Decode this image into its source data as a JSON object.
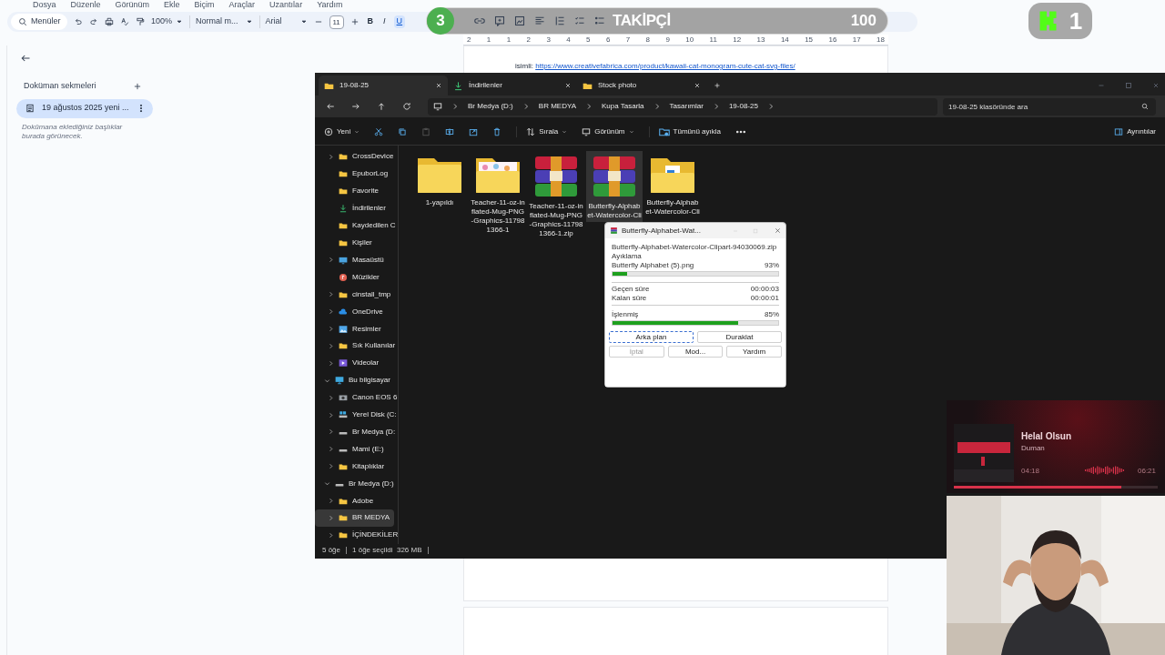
{
  "docs": {
    "menu": [
      "Dosya",
      "Düzenle",
      "Görünüm",
      "Ekle",
      "Biçim",
      "Araçlar",
      "Uzantılar",
      "Yardım"
    ],
    "toolbar": {
      "search": "Menüler",
      "zoom": "100%",
      "style": "Normal m...",
      "font": "Arial",
      "font_size": "11",
      "bold": "B",
      "italic": "I",
      "underline": "U"
    },
    "outline": {
      "title": "Doküman sekmeleri",
      "tabs": [
        {
          "label": "19 ağustos 2025 yeni ...",
          "selected": true
        }
      ],
      "hint": "Dokümana eklediğiniz başlıklar burada görünecek."
    },
    "ruler": [
      "2",
      "1",
      "1",
      "2",
      "3",
      "4",
      "5",
      "6",
      "7",
      "8",
      "9",
      "10",
      "11",
      "12",
      "13",
      "14",
      "15",
      "16",
      "17",
      "18"
    ],
    "text": "isimli:",
    "link": "https://www.creativefabrica.com/product/kawaii-cat-monogram-cute-cat-svg-files/"
  },
  "follower_bar": {
    "step": "3",
    "label": "TAKİPÇİ",
    "count": "100"
  },
  "badge": {
    "count": "1"
  },
  "explorer": {
    "tabs": [
      {
        "label": "19-08-25",
        "kind": "folder",
        "selected": true
      },
      {
        "label": "İndirilenler",
        "kind": "download",
        "selected": false
      },
      {
        "label": "Stock photo",
        "kind": "folder",
        "selected": false
      }
    ],
    "breadcrumbs": [
      "Br Medya (D:)",
      "BR MEDYA",
      "Kupa Tasarla",
      "Tasarımlar",
      "19-08-25"
    ],
    "search": {
      "placeholder": "19-08-25 klasöründe ara"
    },
    "commands": {
      "new": "Yeni",
      "sort": "Sırala",
      "view": "Görünüm",
      "extract": "Tümünü ayıkla",
      "details": "Ayrıntılar"
    },
    "sidebar": [
      {
        "label": "CrossDevice",
        "kind": "folder",
        "collapsed": true,
        "selected": false
      },
      {
        "label": "EpuborLog",
        "kind": "folder",
        "collapsed": false,
        "selected": false
      },
      {
        "label": "Favorite",
        "kind": "folder",
        "collapsed": false,
        "selected": false
      },
      {
        "label": "İndirilenler",
        "kind": "download",
        "collapsed": false,
        "selected": false
      },
      {
        "label": "Kaydedilen C",
        "kind": "folder",
        "collapsed": false,
        "selected": false
      },
      {
        "label": "Kişiler",
        "kind": "folder",
        "collapsed": false,
        "selected": false
      },
      {
        "label": "Masaüstü",
        "kind": "desktop",
        "collapsed": true,
        "selected": false
      },
      {
        "label": "Müzikler",
        "kind": "music",
        "collapsed": false,
        "selected": false
      },
      {
        "label": "cinstall_tmp",
        "kind": "folder",
        "collapsed": true,
        "selected": false
      },
      {
        "label": "OneDrive",
        "kind": "cloud",
        "collapsed": true,
        "selected": false
      },
      {
        "label": "Resimler",
        "kind": "pictures",
        "collapsed": true,
        "selected": false
      },
      {
        "label": "Sık Kullanılar",
        "kind": "folder",
        "collapsed": true,
        "selected": false
      },
      {
        "label": "Videolar",
        "kind": "video",
        "collapsed": true,
        "selected": false
      },
      {
        "label": "Bu bilgisayar",
        "kind": "computer",
        "collapsed": false,
        "selected": false,
        "children": [
          {
            "label": "Canon EOS 6",
            "kind": "camera",
            "collapsed": true,
            "selected": false
          },
          {
            "label": "Yerel Disk (C:",
            "kind": "system-drive",
            "collapsed": true,
            "selected": false
          },
          {
            "label": "Br Medya (D:",
            "kind": "drive",
            "collapsed": true,
            "selected": false
          },
          {
            "label": "Mami (E:)",
            "kind": "drive",
            "collapsed": true,
            "selected": false
          }
        ]
      },
      {
        "label": "Kitaplıklar",
        "kind": "folder",
        "collapsed": true,
        "selected": false
      },
      {
        "label": "Br Medya (D:)",
        "kind": "drive",
        "collapsed": false,
        "selected": false,
        "children": [
          {
            "label": "Adobe",
            "kind": "folder",
            "collapsed": true,
            "selected": false
          },
          {
            "label": "BR MEDYA",
            "kind": "folder",
            "collapsed": true,
            "selected": true
          },
          {
            "label": "İÇİNDEKİLER",
            "kind": "folder",
            "collapsed": true,
            "selected": false
          }
        ]
      }
    ],
    "files": [
      {
        "name": "1-yapıldı",
        "kind": "folder",
        "selected": false
      },
      {
        "name": "Teacher-11-oz-inflated-Mug-PNG-Graphics-117981366-1",
        "kind": "folder-images",
        "selected": false
      },
      {
        "name": "Teacher-11-oz-inflated-Mug-PNG-Graphics-117981366-1.zip",
        "kind": "archive",
        "selected": false
      },
      {
        "name": "Butterfly-Alphabet-Watercolor-Cli",
        "kind": "archive",
        "selected": true
      },
      {
        "name": "Butterfly-Alphabet-Watercolor-Cli",
        "kind": "folder-file",
        "selected": false
      }
    ],
    "status": {
      "count": "5 öğe",
      "selection": "1 öğe seçildi  326 MB"
    }
  },
  "extract_dialog": {
    "title": "Butterfly-Alphabet-Wat...",
    "archive": "Butterfly-Alphabet-Watercolor-Clipart-94030069.zip",
    "action": "Ayıklama",
    "file": {
      "name": "Butterfly Alphabet (5).png",
      "percent": "93%",
      "level": 0.09
    },
    "elapsed": {
      "label": "Geçen süre",
      "value": "00:00:03"
    },
    "remaining": {
      "label": "Kalan süre",
      "value": "00:00:01"
    },
    "processed": {
      "label": "İşlenmiş",
      "percent": "85%",
      "level": 0.76
    },
    "buttons": [
      {
        "label": "Arka plan",
        "focused": true,
        "disabled": false
      },
      {
        "label": "Duraklat",
        "focused": false,
        "disabled": false
      },
      {
        "label": "İptal",
        "focused": false,
        "disabled": true
      },
      {
        "label": "Mod...",
        "focused": false,
        "disabled": false
      },
      {
        "label": "Yardım",
        "focused": false,
        "disabled": false
      }
    ]
  },
  "music": {
    "title": "Helal Olsun",
    "artist": "Duman",
    "elapsed": "04:18",
    "total": "06:21",
    "level": 0.82
  }
}
